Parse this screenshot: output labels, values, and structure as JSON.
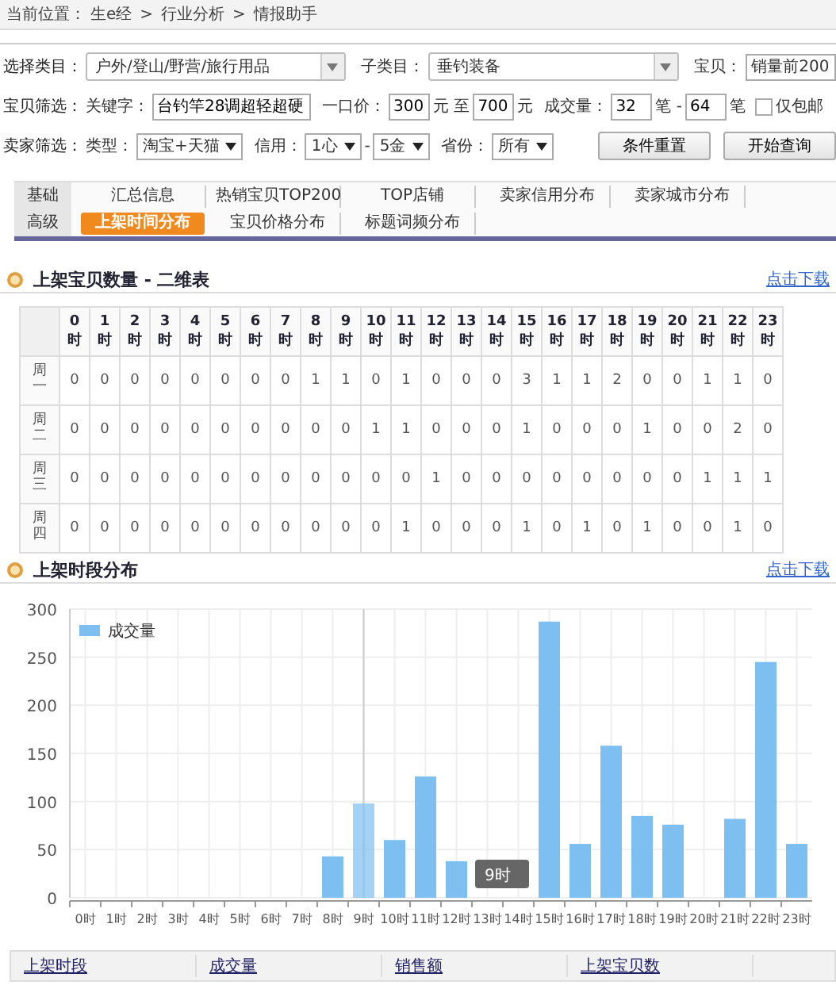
{
  "breadcrumb": {
    "label": "当前位置：",
    "separator": ">",
    "path": [
      "生e经",
      "行业分析",
      "情报助手"
    ]
  },
  "filters": {
    "category_label": "选择类目：",
    "category": "户外/登山/野营/旅行用品",
    "subcategory_label": "子类目：",
    "subcategory": "垂钓装备",
    "item_label": "宝贝：",
    "item": "销量前200",
    "item_filter_label": "宝贝筛选：",
    "keyword_label": "关键字：",
    "keyword": "台钓竿28调超轻超硬",
    "price_label": "一口价：",
    "price_min": "300",
    "price_to": "元 至",
    "price_max": "700",
    "price_unit": "元",
    "volume_label": "成交量：",
    "volume_min": "32",
    "volume_sep": "笔 -",
    "volume_max": "64",
    "volume_unit": "笔",
    "free_shipping": {
      "label": "仅包邮",
      "checked": false
    },
    "seller_filter_label": "卖家筛选：",
    "type_label": "类型：",
    "type": "淘宝+天猫",
    "credit_label": "信用：",
    "credit_min": "1心",
    "credit_sep": "-",
    "credit_max": "5金",
    "province_label": "省份：",
    "province": "所有",
    "buttons": [
      "条件重置",
      "开始查询"
    ]
  },
  "tab_groups": [
    {
      "label": "基础",
      "items": [
        {
          "label": "汇总信息",
          "selected": false
        },
        {
          "label": "热销宝贝TOP200",
          "selected": false
        },
        {
          "label": "TOP店铺",
          "selected": false
        },
        {
          "label": "卖家信用分布",
          "selected": false
        },
        {
          "label": "卖家城市分布",
          "selected": false
        }
      ]
    },
    {
      "label": "高级",
      "items": [
        {
          "label": "上架时间分布",
          "selected": true
        },
        {
          "label": "宝贝价格分布",
          "selected": false
        },
        {
          "label": "标题词频分布",
          "selected": false
        }
      ]
    }
  ],
  "matrix": {
    "title": "上架宝贝数量 - 二维表",
    "download": "点击下载",
    "columns": [
      [
        "0",
        "时"
      ],
      [
        "1",
        "时"
      ],
      [
        "2",
        "时"
      ],
      [
        "3",
        "时"
      ],
      [
        "4",
        "时"
      ],
      [
        "5",
        "时"
      ],
      [
        "6",
        "时"
      ],
      [
        "7",
        "时"
      ],
      [
        "8",
        "时"
      ],
      [
        "9",
        "时"
      ],
      [
        "10",
        "时"
      ],
      [
        "11",
        "时"
      ],
      [
        "12",
        "时"
      ],
      [
        "13",
        "时"
      ],
      [
        "14",
        "时"
      ],
      [
        "15",
        "时"
      ],
      [
        "16",
        "时"
      ],
      [
        "17",
        "时"
      ],
      [
        "18",
        "时"
      ],
      [
        "19",
        "时"
      ],
      [
        "20",
        "时"
      ],
      [
        "21",
        "时"
      ],
      [
        "22",
        "时"
      ],
      [
        "23",
        "时"
      ]
    ],
    "rows": [
      {
        "day": "周一",
        "values": [
          "0",
          "0",
          "0",
          "0",
          "0",
          "0",
          "0",
          "0",
          "1",
          "1",
          "0",
          "1",
          "0",
          "0",
          "0",
          "3",
          "1",
          "1",
          "2",
          "0",
          "0",
          "1",
          "1",
          "0"
        ]
      },
      {
        "day": "周二",
        "values": [
          "0",
          "0",
          "0",
          "0",
          "0",
          "0",
          "0",
          "0",
          "0",
          "0",
          "1",
          "1",
          "0",
          "0",
          "0",
          "1",
          "0",
          "0",
          "0",
          "1",
          "0",
          "0",
          "2",
          "0"
        ]
      },
      {
        "day": "周三",
        "values": [
          "0",
          "0",
          "0",
          "0",
          "0",
          "0",
          "0",
          "0",
          "0",
          "0",
          "0",
          "0",
          "1",
          "0",
          "0",
          "0",
          "0",
          "0",
          "0",
          "0",
          "0",
          "1",
          "1",
          "1"
        ]
      },
      {
        "day": "周四",
        "values": [
          "0",
          "0",
          "0",
          "0",
          "0",
          "0",
          "0",
          "0",
          "0",
          "0",
          "0",
          "1",
          "0",
          "0",
          "0",
          "1",
          "0",
          "1",
          "0",
          "1",
          "0",
          "0",
          "1",
          "0"
        ]
      }
    ]
  },
  "distribution": {
    "title": "上架时段分布",
    "download": "点击下载",
    "tooltip": "9时",
    "chart_data": {
      "type": "bar",
      "grid": true,
      "ref_lines": [
        {
          "axis": "x",
          "value": "9时"
        }
      ],
      "categories": [
        "0时",
        "1时",
        "2时",
        "3时",
        "4时",
        "5时",
        "6时",
        "7时",
        "8时",
        "9时",
        "10时",
        "11时",
        "12时",
        "13时",
        "14时",
        "15时",
        "16时",
        "17时",
        "18时",
        "19时",
        "20时",
        "21时",
        "22时",
        "23时"
      ],
      "series": [
        {
          "name": "成交量",
          "color": "#7dbff0",
          "values": [
            0,
            0,
            0,
            0,
            0,
            0,
            0,
            0,
            43,
            98,
            60,
            126,
            38,
            0,
            0,
            287,
            56,
            158,
            85,
            76,
            0,
            82,
            245,
            56
          ]
        }
      ],
      "ylim": [
        0,
        300
      ],
      "yticks": [
        0,
        50,
        100,
        150,
        200,
        250,
        300
      ]
    }
  },
  "footer_columns": [
    "上架时段",
    "成交量",
    "销售额",
    "上架宝贝数"
  ]
}
